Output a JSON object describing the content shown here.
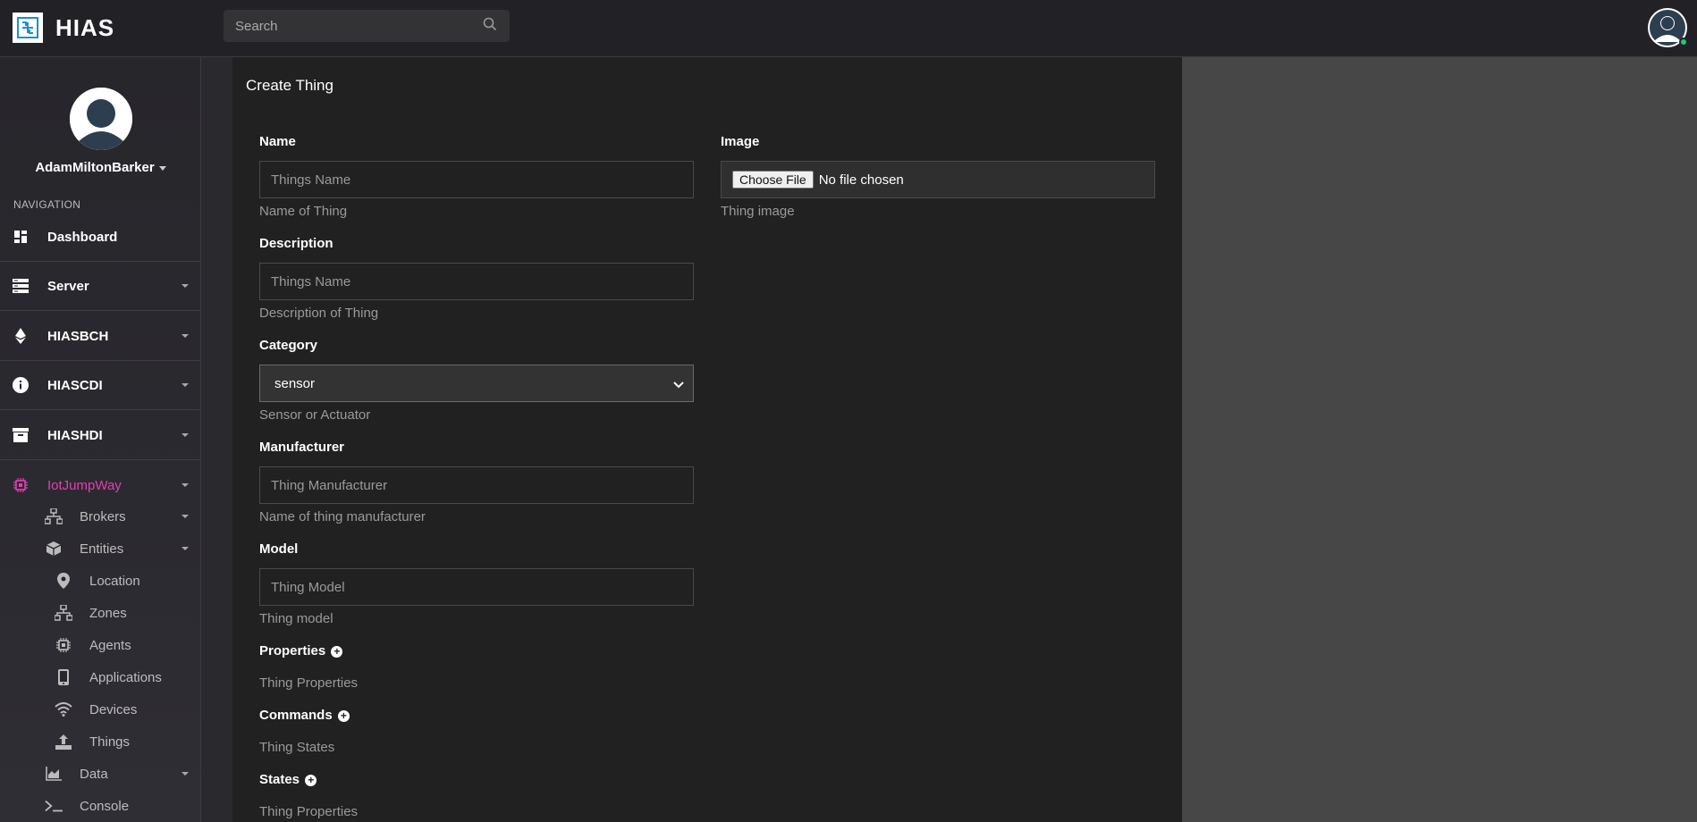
{
  "app": {
    "brand": "HIAS"
  },
  "search": {
    "placeholder": "Search"
  },
  "profile": {
    "name": "AdamMiltonBarker"
  },
  "nav": {
    "header": "NAVIGATION",
    "items": [
      {
        "label": "Dashboard",
        "icon": "dashboard-icon"
      },
      {
        "label": "Server",
        "icon": "server-icon"
      },
      {
        "label": "HIASBCH",
        "icon": "ethereum-icon"
      },
      {
        "label": "HIASCDI",
        "icon": "info-icon"
      },
      {
        "label": "HIASHDI",
        "icon": "archive-icon"
      },
      {
        "label": "IotJumpWay",
        "icon": "chip-icon"
      }
    ],
    "sub": [
      {
        "label": "Brokers",
        "icon": "network-icon"
      },
      {
        "label": "Entities",
        "icon": "cube-icon"
      },
      {
        "label": "Location",
        "icon": "map-pin-icon"
      },
      {
        "label": "Zones",
        "icon": "network-icon"
      },
      {
        "label": "Agents",
        "icon": "chip-icon"
      },
      {
        "label": "Applications",
        "icon": "phone-icon"
      },
      {
        "label": "Devices",
        "icon": "wifi-icon"
      },
      {
        "label": "Things",
        "icon": "upload-icon"
      },
      {
        "label": "Data",
        "icon": "area-chart-icon"
      },
      {
        "label": "Console",
        "icon": "terminal-icon"
      }
    ],
    "active_color": "#e43fb4"
  },
  "form": {
    "title": "Create Thing",
    "name": {
      "label": "Name",
      "placeholder": "Things Name",
      "help": "Name of Thing"
    },
    "description": {
      "label": "Description",
      "placeholder": "Things Name",
      "help": "Description of Thing"
    },
    "category": {
      "label": "Category",
      "value": "sensor",
      "help": "Sensor or Actuator"
    },
    "manufacturer": {
      "label": "Manufacturer",
      "placeholder": "Thing Manufacturer",
      "help": "Name of thing manufacturer"
    },
    "model": {
      "label": "Model",
      "placeholder": "Thing Model",
      "help": "Thing model"
    },
    "properties": {
      "label": "Properties",
      "help": "Thing Properties"
    },
    "commands": {
      "label": "Commands",
      "help": "Thing States"
    },
    "states": {
      "label": "States",
      "help": "Thing Properties"
    },
    "image": {
      "label": "Image",
      "button": "Choose File",
      "status": "No file chosen",
      "help": "Thing image"
    }
  }
}
